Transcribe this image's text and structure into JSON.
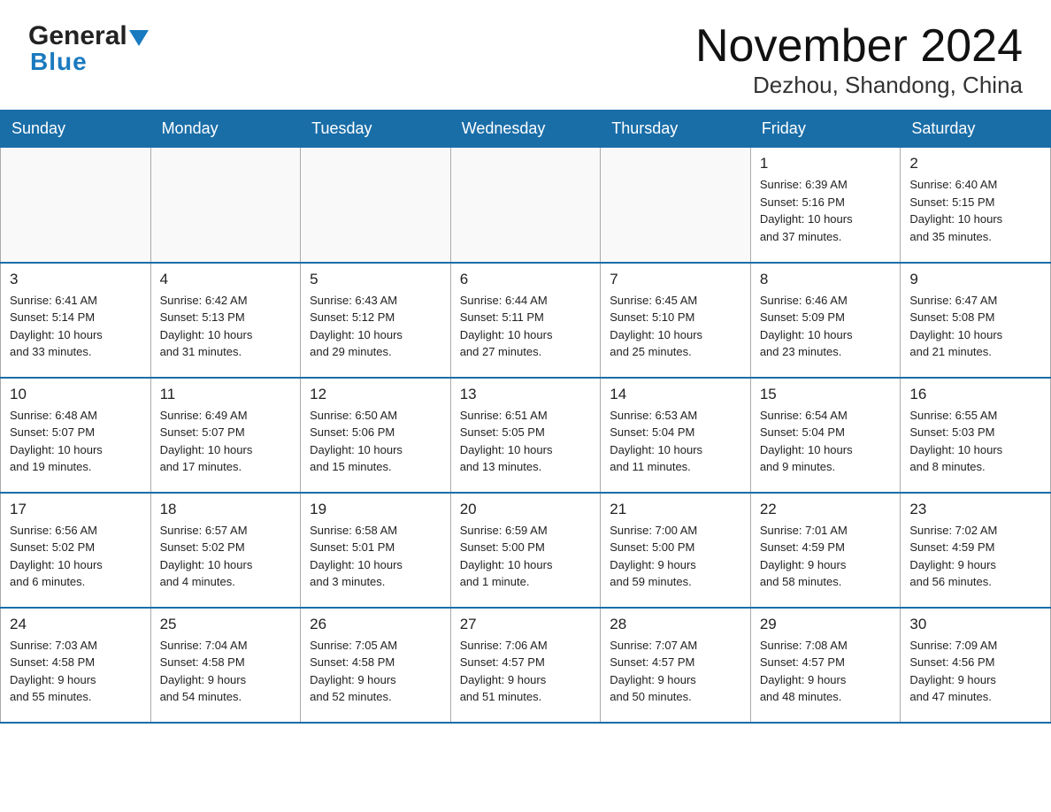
{
  "header": {
    "logo_line1": "General",
    "logo_line2": "Blue",
    "month": "November 2024",
    "location": "Dezhou, Shandong, China"
  },
  "days_of_week": [
    "Sunday",
    "Monday",
    "Tuesday",
    "Wednesday",
    "Thursday",
    "Friday",
    "Saturday"
  ],
  "weeks": [
    [
      {
        "day": "",
        "info": ""
      },
      {
        "day": "",
        "info": ""
      },
      {
        "day": "",
        "info": ""
      },
      {
        "day": "",
        "info": ""
      },
      {
        "day": "",
        "info": ""
      },
      {
        "day": "1",
        "info": "Sunrise: 6:39 AM\nSunset: 5:16 PM\nDaylight: 10 hours\nand 37 minutes."
      },
      {
        "day": "2",
        "info": "Sunrise: 6:40 AM\nSunset: 5:15 PM\nDaylight: 10 hours\nand 35 minutes."
      }
    ],
    [
      {
        "day": "3",
        "info": "Sunrise: 6:41 AM\nSunset: 5:14 PM\nDaylight: 10 hours\nand 33 minutes."
      },
      {
        "day": "4",
        "info": "Sunrise: 6:42 AM\nSunset: 5:13 PM\nDaylight: 10 hours\nand 31 minutes."
      },
      {
        "day": "5",
        "info": "Sunrise: 6:43 AM\nSunset: 5:12 PM\nDaylight: 10 hours\nand 29 minutes."
      },
      {
        "day": "6",
        "info": "Sunrise: 6:44 AM\nSunset: 5:11 PM\nDaylight: 10 hours\nand 27 minutes."
      },
      {
        "day": "7",
        "info": "Sunrise: 6:45 AM\nSunset: 5:10 PM\nDaylight: 10 hours\nand 25 minutes."
      },
      {
        "day": "8",
        "info": "Sunrise: 6:46 AM\nSunset: 5:09 PM\nDaylight: 10 hours\nand 23 minutes."
      },
      {
        "day": "9",
        "info": "Sunrise: 6:47 AM\nSunset: 5:08 PM\nDaylight: 10 hours\nand 21 minutes."
      }
    ],
    [
      {
        "day": "10",
        "info": "Sunrise: 6:48 AM\nSunset: 5:07 PM\nDaylight: 10 hours\nand 19 minutes."
      },
      {
        "day": "11",
        "info": "Sunrise: 6:49 AM\nSunset: 5:07 PM\nDaylight: 10 hours\nand 17 minutes."
      },
      {
        "day": "12",
        "info": "Sunrise: 6:50 AM\nSunset: 5:06 PM\nDaylight: 10 hours\nand 15 minutes."
      },
      {
        "day": "13",
        "info": "Sunrise: 6:51 AM\nSunset: 5:05 PM\nDaylight: 10 hours\nand 13 minutes."
      },
      {
        "day": "14",
        "info": "Sunrise: 6:53 AM\nSunset: 5:04 PM\nDaylight: 10 hours\nand 11 minutes."
      },
      {
        "day": "15",
        "info": "Sunrise: 6:54 AM\nSunset: 5:04 PM\nDaylight: 10 hours\nand 9 minutes."
      },
      {
        "day": "16",
        "info": "Sunrise: 6:55 AM\nSunset: 5:03 PM\nDaylight: 10 hours\nand 8 minutes."
      }
    ],
    [
      {
        "day": "17",
        "info": "Sunrise: 6:56 AM\nSunset: 5:02 PM\nDaylight: 10 hours\nand 6 minutes."
      },
      {
        "day": "18",
        "info": "Sunrise: 6:57 AM\nSunset: 5:02 PM\nDaylight: 10 hours\nand 4 minutes."
      },
      {
        "day": "19",
        "info": "Sunrise: 6:58 AM\nSunset: 5:01 PM\nDaylight: 10 hours\nand 3 minutes."
      },
      {
        "day": "20",
        "info": "Sunrise: 6:59 AM\nSunset: 5:00 PM\nDaylight: 10 hours\nand 1 minute."
      },
      {
        "day": "21",
        "info": "Sunrise: 7:00 AM\nSunset: 5:00 PM\nDaylight: 9 hours\nand 59 minutes."
      },
      {
        "day": "22",
        "info": "Sunrise: 7:01 AM\nSunset: 4:59 PM\nDaylight: 9 hours\nand 58 minutes."
      },
      {
        "day": "23",
        "info": "Sunrise: 7:02 AM\nSunset: 4:59 PM\nDaylight: 9 hours\nand 56 minutes."
      }
    ],
    [
      {
        "day": "24",
        "info": "Sunrise: 7:03 AM\nSunset: 4:58 PM\nDaylight: 9 hours\nand 55 minutes."
      },
      {
        "day": "25",
        "info": "Sunrise: 7:04 AM\nSunset: 4:58 PM\nDaylight: 9 hours\nand 54 minutes."
      },
      {
        "day": "26",
        "info": "Sunrise: 7:05 AM\nSunset: 4:58 PM\nDaylight: 9 hours\nand 52 minutes."
      },
      {
        "day": "27",
        "info": "Sunrise: 7:06 AM\nSunset: 4:57 PM\nDaylight: 9 hours\nand 51 minutes."
      },
      {
        "day": "28",
        "info": "Sunrise: 7:07 AM\nSunset: 4:57 PM\nDaylight: 9 hours\nand 50 minutes."
      },
      {
        "day": "29",
        "info": "Sunrise: 7:08 AM\nSunset: 4:57 PM\nDaylight: 9 hours\nand 48 minutes."
      },
      {
        "day": "30",
        "info": "Sunrise: 7:09 AM\nSunset: 4:56 PM\nDaylight: 9 hours\nand 47 minutes."
      }
    ]
  ]
}
